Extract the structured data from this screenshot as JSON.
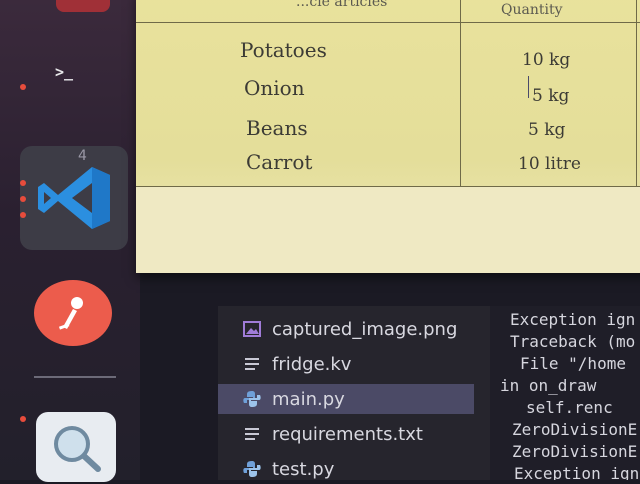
{
  "dock": {
    "terminal_glyph": ">_",
    "vscode_badge": "4",
    "accent": "#ec5c4c",
    "vscode_blue": "#2b8fe0"
  },
  "paper": {
    "headers": [
      "...cle articles",
      "Quantity"
    ],
    "rows": [
      {
        "item": "Potatoes",
        "qty": "10 kg"
      },
      {
        "item": "Onion",
        "qty": "5 kg"
      },
      {
        "item": "Beans",
        "qty": "5 kg"
      },
      {
        "item": "Carrot",
        "qty": "10 litre"
      }
    ]
  },
  "explorer": {
    "files": [
      {
        "name": "captured_image.png",
        "icon": "image-file-icon"
      },
      {
        "name": "fridge.kv",
        "icon": "text-file-icon"
      },
      {
        "name": "main.py",
        "icon": "python-file-icon",
        "selected": true
      },
      {
        "name": "requirements.txt",
        "icon": "text-file-icon"
      },
      {
        "name": "test.py",
        "icon": "python-file-icon"
      }
    ]
  },
  "terminal": {
    "lines": [
      "Exception ign",
      "Traceback (mo",
      "  File \"/home",
      "in on_draw",
      "    self.renc",
      "ZeroDivisionE",
      "ZeroDivisionE",
      "Exception ign"
    ]
  }
}
